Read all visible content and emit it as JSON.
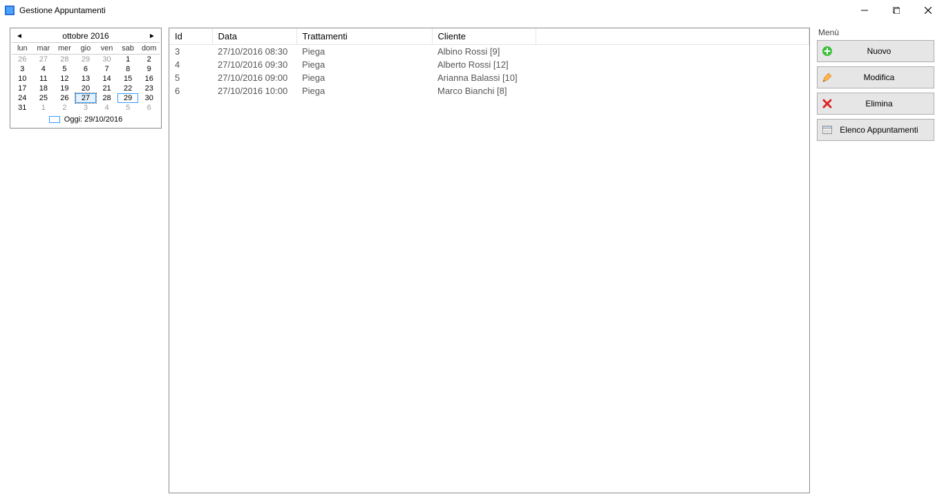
{
  "window": {
    "title": "Gestione Appuntamenti"
  },
  "calendar": {
    "month_label": "ottobre 2016",
    "dow": [
      "lun",
      "mar",
      "mer",
      "gio",
      "ven",
      "sab",
      "dom"
    ],
    "weeks": [
      [
        {
          "n": "26",
          "other": true
        },
        {
          "n": "27",
          "other": true
        },
        {
          "n": "28",
          "other": true
        },
        {
          "n": "29",
          "other": true
        },
        {
          "n": "30",
          "other": true
        },
        {
          "n": "1"
        },
        {
          "n": "2"
        }
      ],
      [
        {
          "n": "3"
        },
        {
          "n": "4"
        },
        {
          "n": "5"
        },
        {
          "n": "6"
        },
        {
          "n": "7"
        },
        {
          "n": "8"
        },
        {
          "n": "9"
        }
      ],
      [
        {
          "n": "10"
        },
        {
          "n": "11"
        },
        {
          "n": "12"
        },
        {
          "n": "13"
        },
        {
          "n": "14"
        },
        {
          "n": "15"
        },
        {
          "n": "16"
        }
      ],
      [
        {
          "n": "17"
        },
        {
          "n": "18"
        },
        {
          "n": "19"
        },
        {
          "n": "20"
        },
        {
          "n": "21"
        },
        {
          "n": "22"
        },
        {
          "n": "23"
        }
      ],
      [
        {
          "n": "24"
        },
        {
          "n": "25"
        },
        {
          "n": "26"
        },
        {
          "n": "27",
          "selected": true
        },
        {
          "n": "28"
        },
        {
          "n": "29",
          "today": true
        },
        {
          "n": "30"
        }
      ],
      [
        {
          "n": "31"
        },
        {
          "n": "1",
          "other": true
        },
        {
          "n": "2",
          "other": true
        },
        {
          "n": "3",
          "other": true
        },
        {
          "n": "4",
          "other": true
        },
        {
          "n": "5",
          "other": true
        },
        {
          "n": "6",
          "other": true
        }
      ]
    ],
    "today_label": "Oggi: 29/10/2016"
  },
  "table": {
    "headers": {
      "id": "Id",
      "data": "Data",
      "tratt": "Trattamenti",
      "cliente": "Cliente"
    },
    "rows": [
      {
        "id": "3",
        "data": "27/10/2016 08:30",
        "tratt": "Piega",
        "cliente": "Albino Rossi [9]"
      },
      {
        "id": "4",
        "data": "27/10/2016 09:30",
        "tratt": "Piega",
        "cliente": "Alberto Rossi [12]"
      },
      {
        "id": "5",
        "data": "27/10/2016 09:00",
        "tratt": "Piega",
        "cliente": "Arianna Balassi [10]"
      },
      {
        "id": "6",
        "data": "27/10/2016 10:00",
        "tratt": "Piega",
        "cliente": "Marco Bianchi [8]"
      }
    ]
  },
  "menu": {
    "title": "Menù",
    "nuovo": "Nuovo",
    "modifica": "Modifica",
    "elimina": "Elimina",
    "elenco": "Elenco Appuntamenti"
  }
}
